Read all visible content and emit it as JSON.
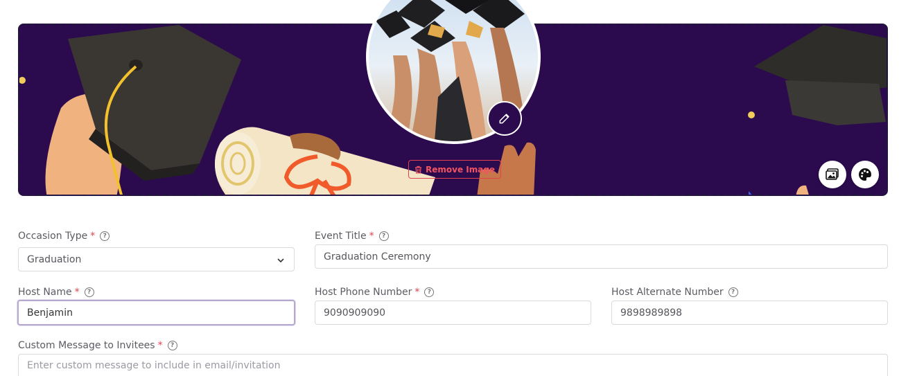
{
  "banner": {
    "remove_image_label": "Remove Image",
    "colors": {
      "background": "#2b0a4e",
      "remove": "#f25461"
    },
    "icons": {
      "edit": "pencil-icon",
      "remove": "trash-icon",
      "change_bg": "image-icon",
      "theme": "palette-icon"
    }
  },
  "form": {
    "occasion_type": {
      "label": "Occasion Type",
      "required": "*",
      "value": "Graduation"
    },
    "event_title": {
      "label": "Event Title",
      "required": "*",
      "value": "Graduation Ceremony"
    },
    "host_name": {
      "label": "Host Name",
      "required": "*",
      "value": "Benjamin"
    },
    "host_phone": {
      "label": "Host Phone Number",
      "required": "*",
      "value": "9090909090"
    },
    "host_alt": {
      "label": "Host Alternate Number",
      "value": "9898989898"
    },
    "custom_message": {
      "label": "Custom Message to Invitees",
      "required": "*",
      "placeholder": "Enter custom message to include in email/invitation"
    }
  }
}
